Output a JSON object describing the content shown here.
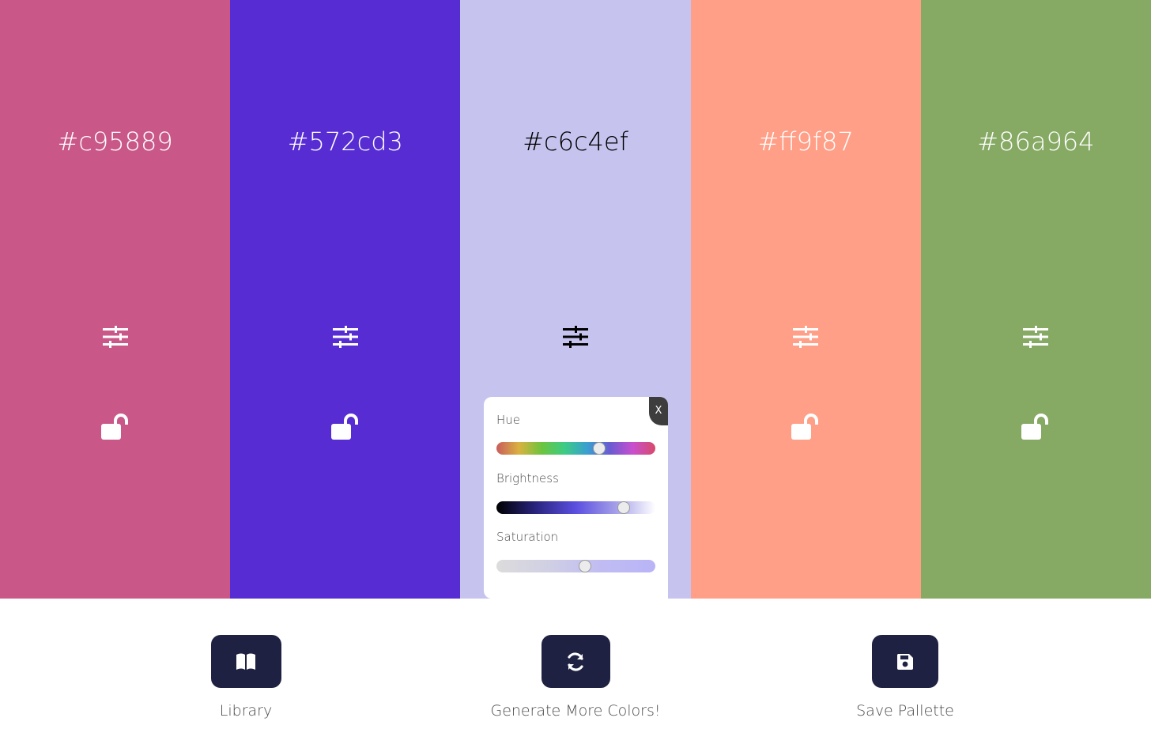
{
  "palette": {
    "swatches": [
      {
        "hex": "#c95889",
        "color": "#c95889",
        "text_color": "#ffffff",
        "icon_color": "#ffffff"
      },
      {
        "hex": "#572cd3",
        "color": "#572cd3",
        "text_color": "#ffffff",
        "icon_color": "#ffffff"
      },
      {
        "hex": "#c6c4ef",
        "color": "#c6c4ef",
        "text_color": "#000000",
        "icon_color": "#000000"
      },
      {
        "hex": "#ff9f87",
        "color": "#ff9f87",
        "text_color": "#ffffff",
        "icon_color": "#ffffff"
      },
      {
        "hex": "#86a964",
        "color": "#86a964",
        "text_color": "#ffffff",
        "icon_color": "#ffffff"
      }
    ],
    "icons": {
      "adjust": "sliders-icon",
      "lock": "unlocked-icon"
    }
  },
  "adjust_panel": {
    "close_label": "X",
    "hue_label": "Hue",
    "hue_value": 0.66,
    "brightness_label": "Brightness",
    "brightness_value": 0.825,
    "saturation_label": "Saturation",
    "saturation_value": 0.56
  },
  "controls": {
    "library": {
      "label": "Library",
      "icon": "book-icon"
    },
    "generate": {
      "label": "Generate More Colors!",
      "icon": "refresh-icon"
    },
    "save": {
      "label": "Save Pallette",
      "icon": "save-icon"
    },
    "button_color": "#1f2142"
  }
}
